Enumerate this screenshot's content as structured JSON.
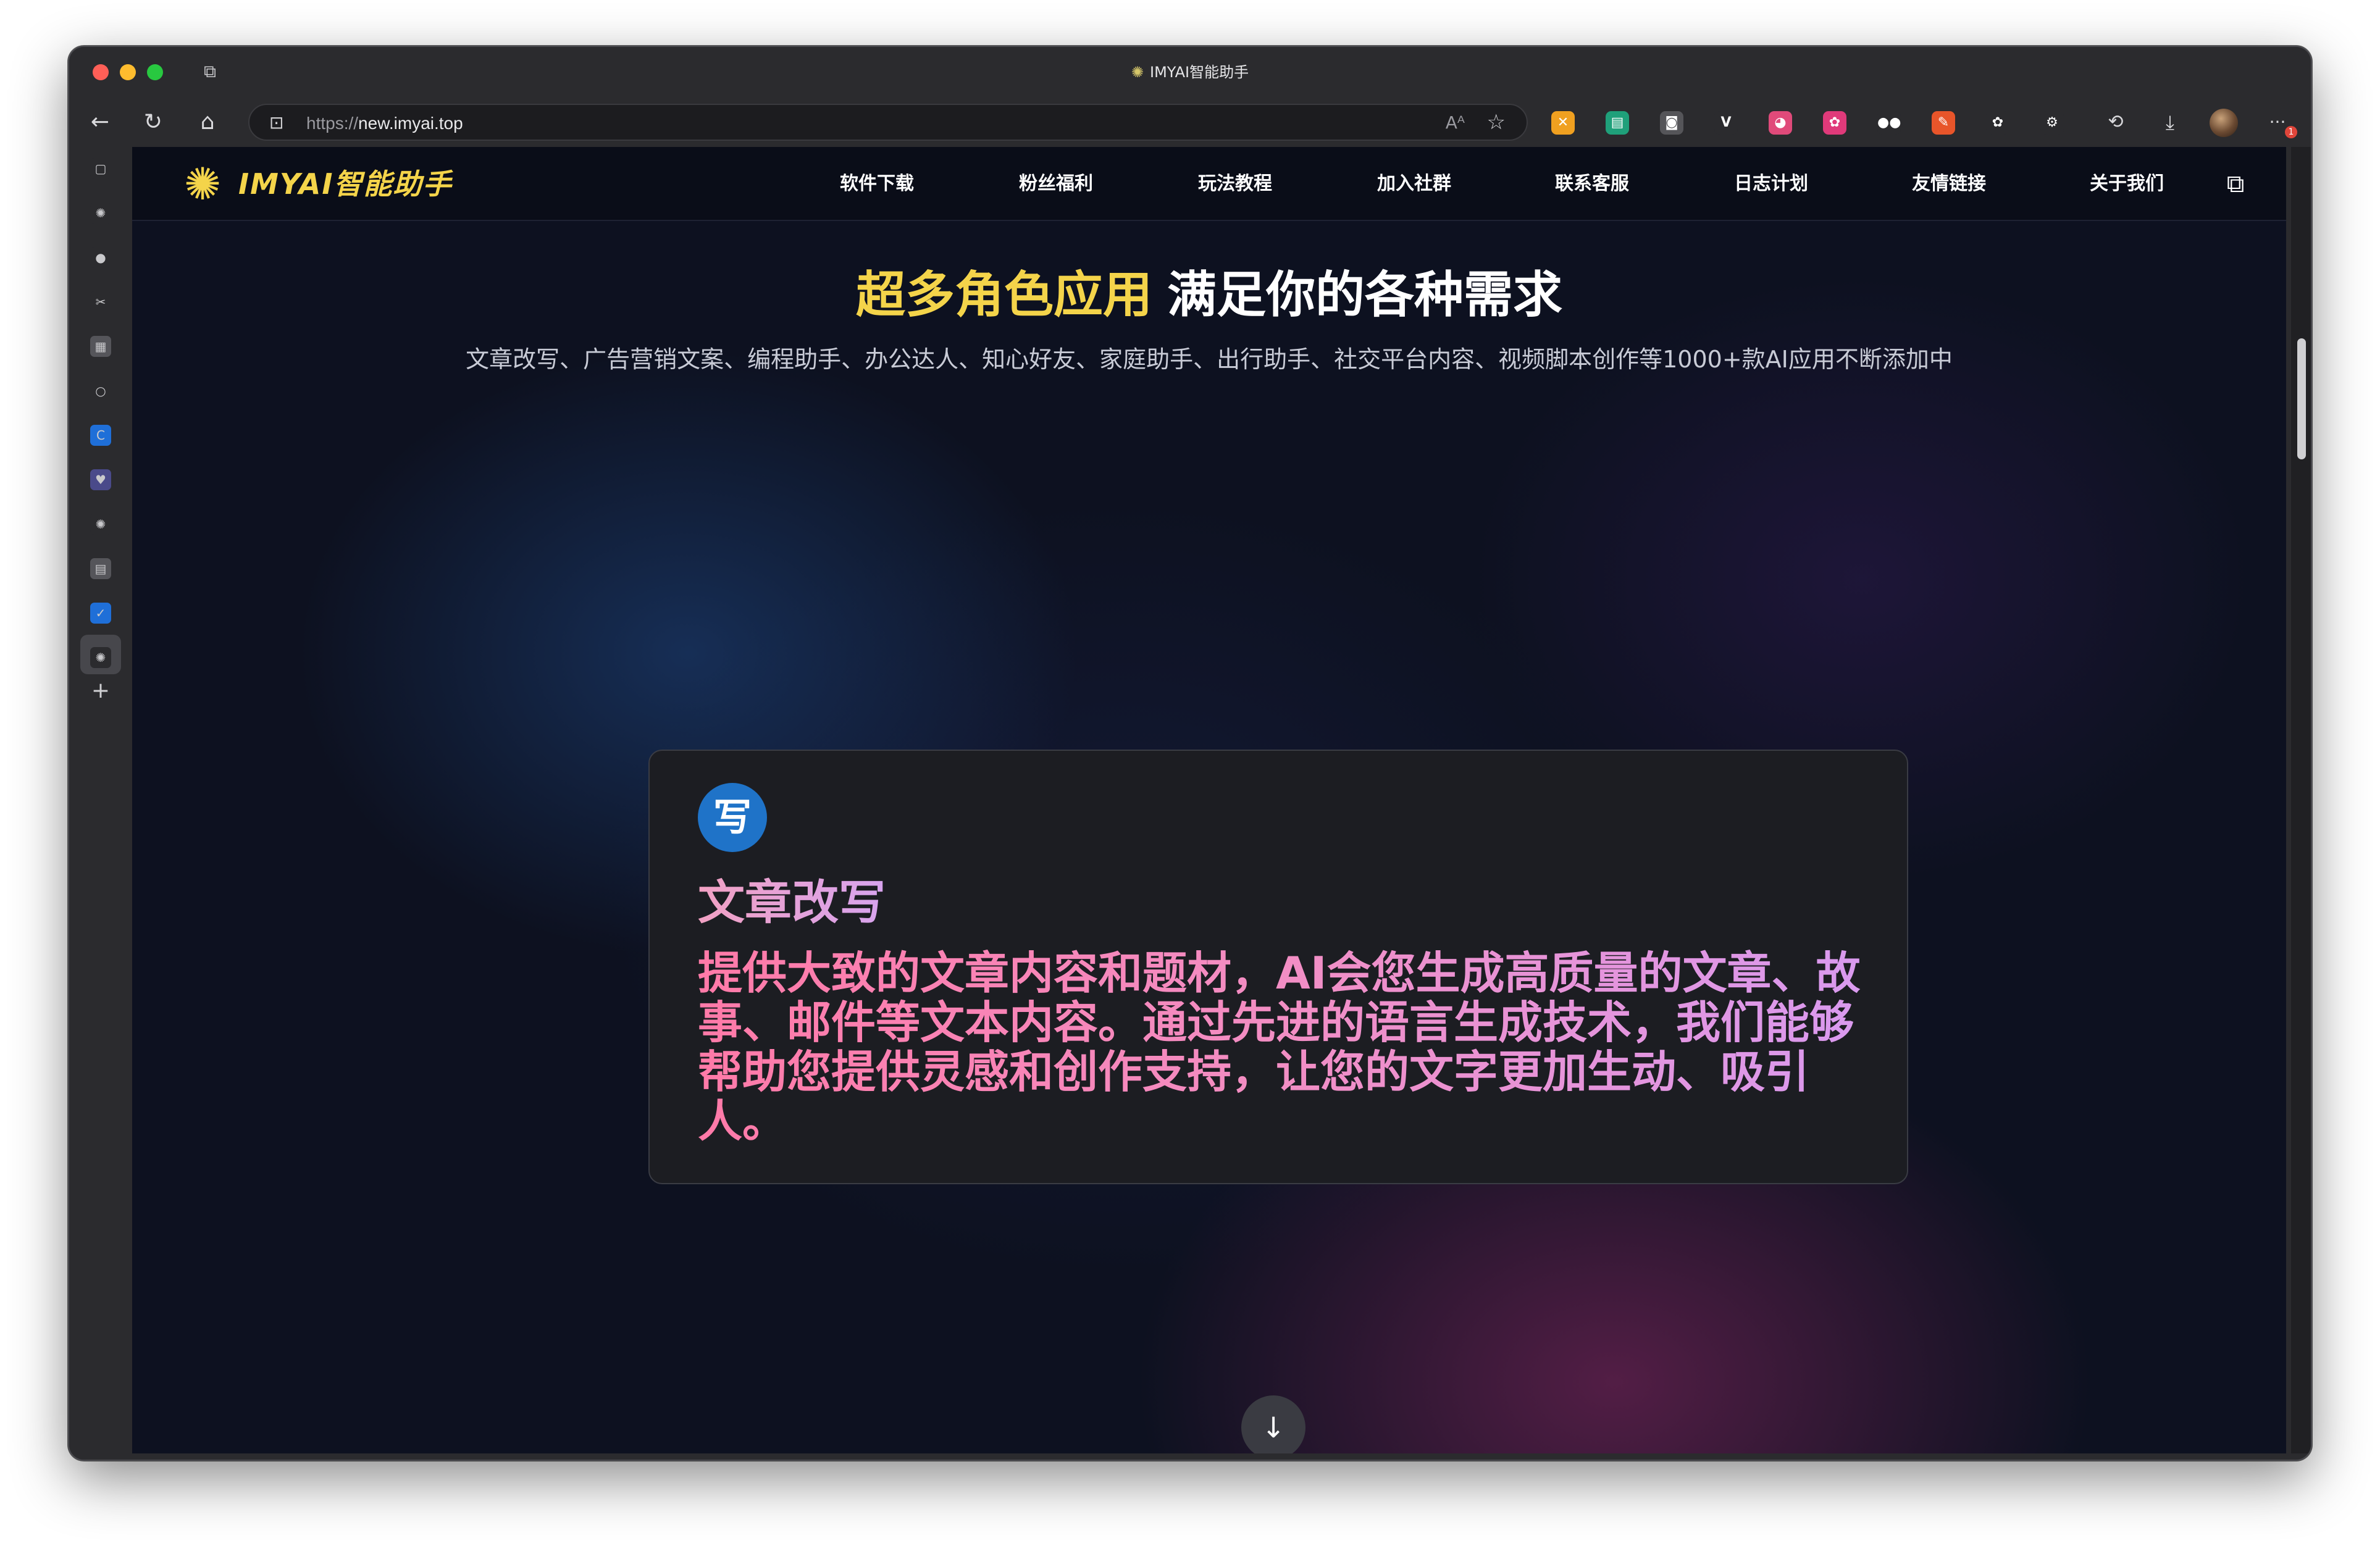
{
  "window": {
    "title": "IMYAI智能助手",
    "favicon": "openai-knot-icon"
  },
  "toolbar": {
    "url_protocol": "https://",
    "url_host": "new.imyai.top",
    "back_icon": "←",
    "reload_icon": "↻",
    "home_icon": "⌂",
    "lock_icon": "🔒",
    "read_aloud_icon": "Aᴬ",
    "favorite_icon": "☆",
    "history_icon": "⟲",
    "download_icon": "⤓",
    "more_icon": "···",
    "notification_count": "1",
    "extensions": [
      {
        "name": "extension-1-icon",
        "glyph": "✕",
        "color": "#f0a020"
      },
      {
        "name": "extension-2-icon",
        "glyph": "▤",
        "color": "#1fa07a"
      },
      {
        "name": "extension-3-icon",
        "glyph": "◙",
        "color": "#555559"
      },
      {
        "name": "vue-devtools-icon",
        "glyph": "V",
        "color": "#2b2b2e"
      },
      {
        "name": "extension-5-icon",
        "glyph": "◕",
        "color": "#e04a7a"
      },
      {
        "name": "extension-6-icon",
        "glyph": "✿",
        "color": "#e03a7a"
      },
      {
        "name": "medium-icon",
        "glyph": "●●",
        "color": "#2b2b2e"
      },
      {
        "name": "extension-8-icon",
        "glyph": "✎",
        "color": "#e8552a"
      },
      {
        "name": "extension-9-icon",
        "glyph": "✿",
        "color": "#2b2b2e"
      },
      {
        "name": "puzzle-extensions-icon",
        "glyph": "⚙",
        "color": "#2b2b2e"
      }
    ]
  },
  "sidebar": {
    "items": [
      {
        "name": "sidebar-tab-actions-icon",
        "glyph": "▢",
        "color": "#2b2b2e"
      },
      {
        "name": "sidebar-tab-openai-1-icon",
        "glyph": "✺",
        "color": "#2b2b2e"
      },
      {
        "name": "sidebar-tab-2-icon",
        "glyph": "●",
        "color": "#2b2b2e"
      },
      {
        "name": "sidebar-tab-3-icon",
        "glyph": "✂",
        "color": "#2b2b2e"
      },
      {
        "name": "sidebar-tab-4-icon",
        "glyph": "▦",
        "color": "#55555a"
      },
      {
        "name": "sidebar-tab-5-icon",
        "glyph": "○",
        "color": "#2b2b2e"
      },
      {
        "name": "sidebar-tab-6-icon",
        "glyph": "C",
        "color": "#1f6fd8"
      },
      {
        "name": "sidebar-tab-7-icon",
        "glyph": "♥",
        "color": "#4a4a8a"
      },
      {
        "name": "sidebar-tab-openai-2-icon",
        "glyph": "✺",
        "color": "#2b2b2e"
      },
      {
        "name": "sidebar-tab-8-icon",
        "glyph": "▤",
        "color": "#55555a"
      },
      {
        "name": "sidebar-tab-9-icon",
        "glyph": "✓",
        "color": "#1f6fd8"
      },
      {
        "name": "sidebar-tab-openai-active-icon",
        "glyph": "✺",
        "color": "#2b2b2e"
      }
    ],
    "add_icon": "+"
  },
  "nav": {
    "logo_text": "IMYAI智能助手",
    "items": [
      "软件下载",
      "粉丝福利",
      "玩法教程",
      "加入社群",
      "联系客服",
      "日志计划",
      "友情链接",
      "关于我们"
    ],
    "copy_icon": "⧉"
  },
  "hero": {
    "title_highlight": "超多角色应用",
    "title_rest": "满足你的各种需求",
    "subtitle": "文章改写、广告营销文案、编程助手、办公达人、知心好友、家庭助手、出行助手、社交平台内容、视频脚本创作等1000+款AI应用不断添加中"
  },
  "card": {
    "icon_glyph": "写",
    "title": "文章改写",
    "description": "提供大致的文章内容和题材，AI会您生成高质量的文章、故事、邮件等文本内容。通过先进的语言生成技术，我们能够帮助您提供灵感和创作支持，让您的文字更加生动、吸引人。"
  },
  "scroll_down_icon": "↓",
  "colors": {
    "accent_yellow": "#f4d44a",
    "card_text_pink": "#ff7aa8",
    "card_text_violet": "#d99af0",
    "page_bg": "#0d1120"
  }
}
